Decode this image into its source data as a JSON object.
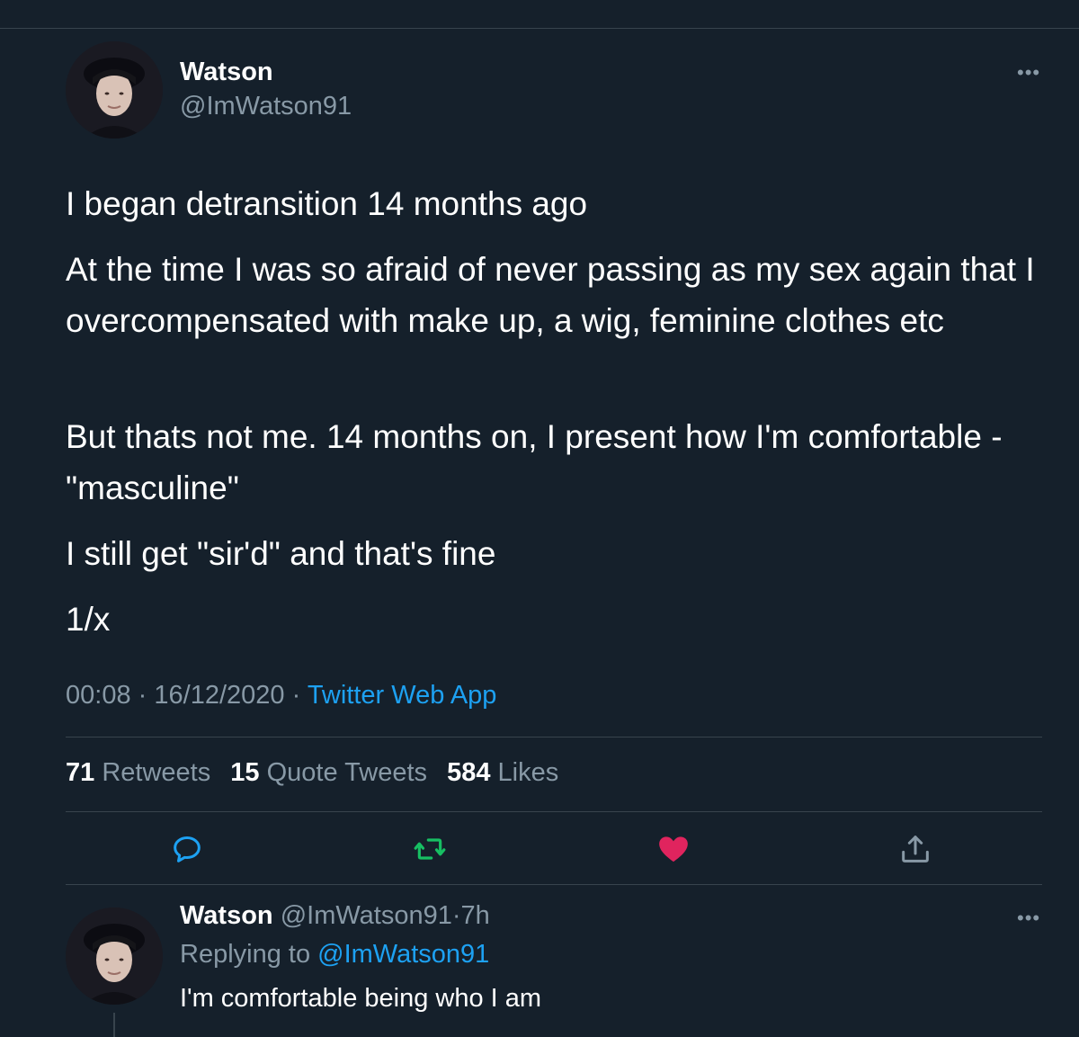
{
  "tweet": {
    "author_name": "Watson",
    "author_handle": "@ImWatson91",
    "paragraphs": [
      "I began detransition 14 months ago",
      "At the time I was so afraid of never passing as my sex again that I overcompensated with make up, a wig, feminine clothes etc",
      "But thats not me. 14 months on, I present how I'm comfortable - \"masculine\"",
      "I still get \"sir'd\" and that's fine",
      "1/x"
    ],
    "time": "00:08",
    "date": "16/12/2020",
    "source": "Twitter Web App",
    "separator": "·",
    "more_icon": "more-horizontal-icon"
  },
  "stats": {
    "retweets_count": "71",
    "retweets_label": "Retweets",
    "quotes_count": "15",
    "quotes_label": "Quote Tweets",
    "likes_count": "584",
    "likes_label": "Likes"
  },
  "actions": {
    "reply_icon": "reply-icon",
    "retweet_icon": "retweet-icon",
    "like_icon": "heart-icon",
    "share_icon": "share-icon",
    "retweet_color": "#17bf63",
    "like_color": "#e0245e"
  },
  "reply": {
    "author_name": "Watson",
    "author_handle": "@ImWatson91",
    "separator": "·",
    "age": "7h",
    "replying_prefix": "Replying to",
    "replying_handle": "@ImWatson91",
    "text": "I'm comfortable being who I am"
  },
  "colors": {
    "background": "#15202b",
    "muted_text": "#8899a6",
    "link": "#1da1f2",
    "divider": "#38444d"
  }
}
